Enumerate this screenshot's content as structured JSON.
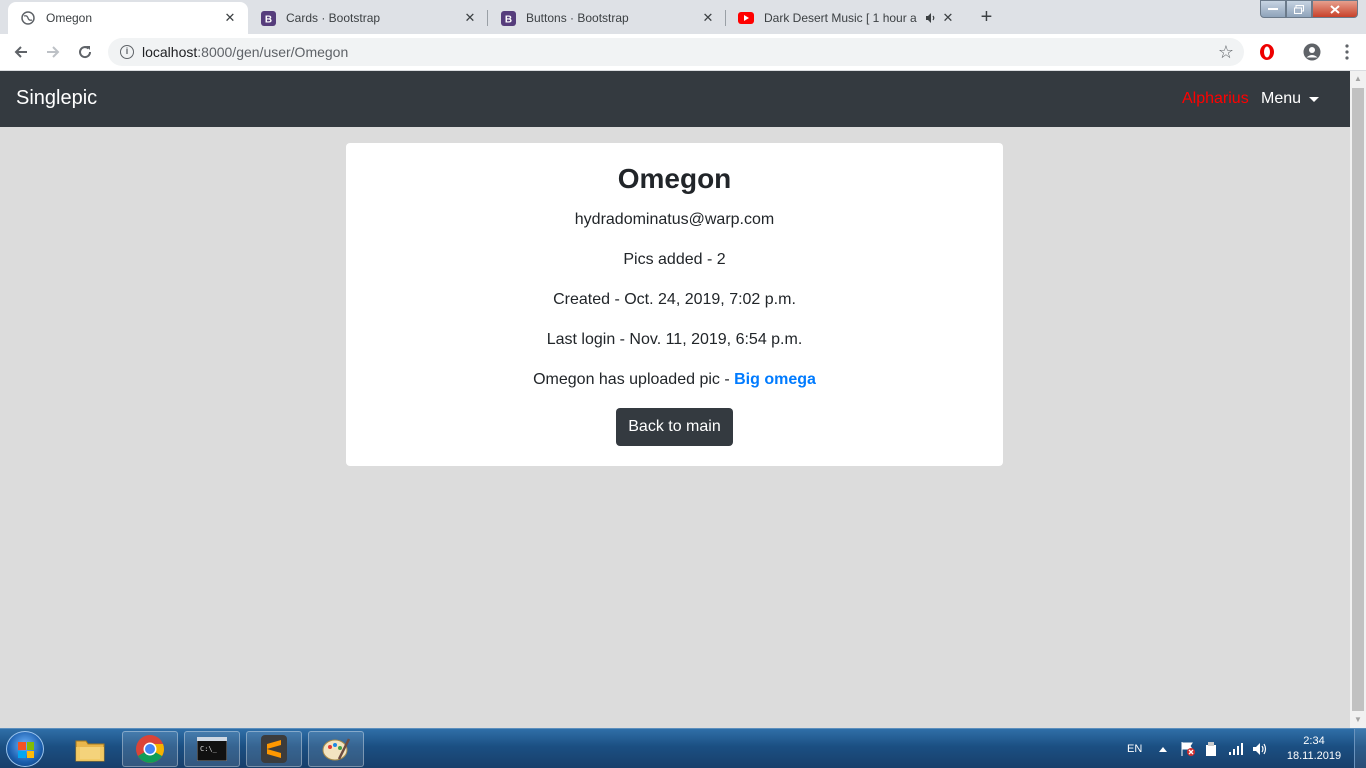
{
  "browser": {
    "tabs": [
      {
        "title": "Omegon",
        "active": true,
        "icon": "globe-icon"
      },
      {
        "title": "Cards · Bootstrap",
        "active": false,
        "icon": "bootstrap-icon"
      },
      {
        "title": "Buttons · Bootstrap",
        "active": false,
        "icon": "bootstrap-icon"
      },
      {
        "title": "Dark Desert Music [ 1 hour a",
        "active": false,
        "icon": "youtube-icon",
        "audio": true
      }
    ],
    "close_glyph": "✕",
    "new_tab_glyph": "+",
    "address": {
      "host": "localhost",
      "path": ":8000/gen/user/Omegon"
    }
  },
  "site": {
    "brand": "Singlepic",
    "current_user": "Alpharius",
    "menu_label": "Menu"
  },
  "profile": {
    "username": "Omegon",
    "email": "hydradominatus@warp.com",
    "pics_added": "Pics added - 2",
    "created": "Created - Oct. 24, 2019, 7:02 p.m.",
    "last_login": "Last login - Nov. 11, 2019, 6:54 p.m.",
    "upload_prefix": "Omegon has uploaded pic - ",
    "upload_link": "Big omega",
    "back_button": "Back to main"
  },
  "taskbar": {
    "language": "EN",
    "time": "2:34",
    "date": "18.11.2019",
    "items": [
      "windows-explorer-icon",
      "chrome-icon",
      "command-prompt-icon",
      "sublime-text-icon",
      "paint-icon"
    ]
  },
  "colors": {
    "navbar": "#343a40",
    "current_user": "#ff0000",
    "link": "#007bff",
    "page_bg": "#dcdcdc"
  }
}
